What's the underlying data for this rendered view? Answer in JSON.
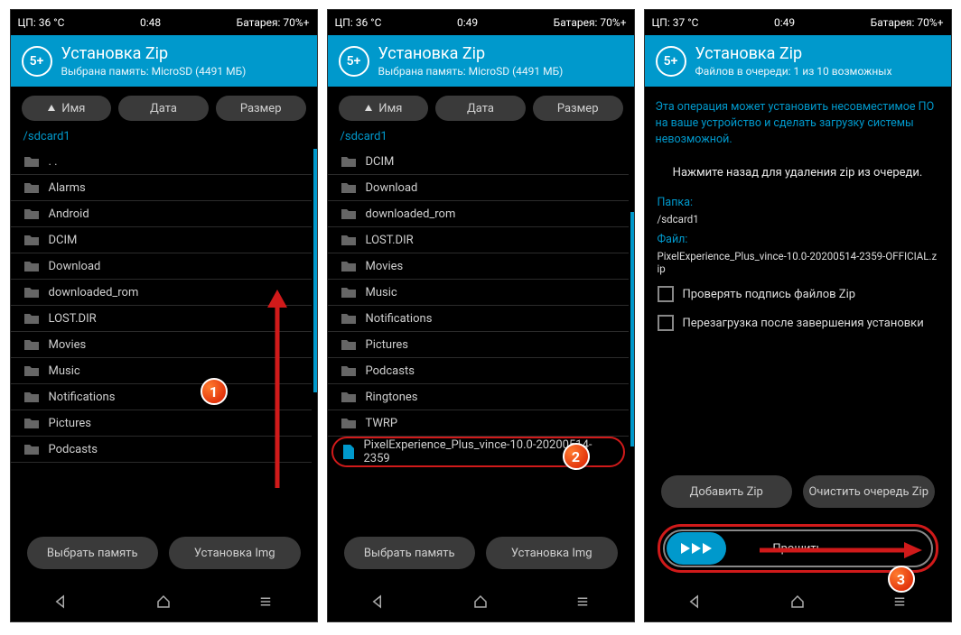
{
  "panels": [
    {
      "status": {
        "cpu": "ЦП: 36 °C",
        "time": "0:48",
        "battery": "Батарея: 70%+"
      },
      "header": {
        "icon": "5+",
        "title": "Установка Zip",
        "sub": "Выбрана память: MicroSD (4491 МБ)"
      },
      "sort": [
        "Имя",
        "Дата",
        "Размер"
      ],
      "path": "/sdcard1",
      "items": [
        {
          "type": "folder",
          "name": ". ."
        },
        {
          "type": "folder",
          "name": "Alarms"
        },
        {
          "type": "folder",
          "name": "Android"
        },
        {
          "type": "folder",
          "name": "DCIM"
        },
        {
          "type": "folder",
          "name": "Download"
        },
        {
          "type": "folder",
          "name": "downloaded_rom"
        },
        {
          "type": "folder",
          "name": "LOST.DIR"
        },
        {
          "type": "folder",
          "name": "Movies"
        },
        {
          "type": "folder",
          "name": "Music"
        },
        {
          "type": "folder",
          "name": "Notifications"
        },
        {
          "type": "folder",
          "name": "Pictures"
        },
        {
          "type": "folder",
          "name": "Podcasts"
        }
      ],
      "buttons": {
        "left": "Выбрать память",
        "right": "Установка Img"
      },
      "callout": "1"
    },
    {
      "status": {
        "cpu": "ЦП: 36 °C",
        "time": "0:49",
        "battery": "Батарея: 70%+"
      },
      "header": {
        "icon": "5+",
        "title": "Установка Zip",
        "sub": "Выбрана память: MicroSD (4491 МБ)"
      },
      "sort": [
        "Имя",
        "Дата",
        "Размер"
      ],
      "path": "/sdcard1",
      "items": [
        {
          "type": "folder",
          "name": "DCIM"
        },
        {
          "type": "folder",
          "name": "Download"
        },
        {
          "type": "folder",
          "name": "downloaded_rom"
        },
        {
          "type": "folder",
          "name": "LOST.DIR"
        },
        {
          "type": "folder",
          "name": "Movies"
        },
        {
          "type": "folder",
          "name": "Music"
        },
        {
          "type": "folder",
          "name": "Notifications"
        },
        {
          "type": "folder",
          "name": "Pictures"
        },
        {
          "type": "folder",
          "name": "Podcasts"
        },
        {
          "type": "folder",
          "name": "Ringtones"
        },
        {
          "type": "folder",
          "name": "TWRP"
        },
        {
          "type": "file",
          "name": "PixelExperience_Plus_vince-10.0-20200514-2359",
          "highlight": true
        }
      ],
      "buttons": {
        "left": "Выбрать память",
        "right": "Установка Img"
      },
      "callout": "2"
    },
    {
      "status": {
        "cpu": "ЦП: 37 °C",
        "time": "0:49",
        "battery": "Батарея: 70%+"
      },
      "header": {
        "icon": "5+",
        "title": "Установка Zip",
        "sub": "Файлов в очереди: 1 из 10 возможных"
      },
      "warn": "Эта операция может установить несовместимое ПО на ваше устройство и сделать загрузку системы невозможной.",
      "hint": "Нажмите назад для удаления zip из очереди.",
      "folder_label": "Папка:",
      "folder_value": "/sdcard1",
      "file_label": "Файл:",
      "file_value": "PixelExperience_Plus_vince-10.0-20200514-2359-OFFICIAL.zip",
      "check1": "Проверять подпись файлов Zip",
      "check2": "Перезагрузка после завершения установки",
      "buttons": {
        "left": "Добавить Zip",
        "right": "Очистить очередь Zip"
      },
      "slider": "Прошить",
      "callout": "3"
    }
  ]
}
